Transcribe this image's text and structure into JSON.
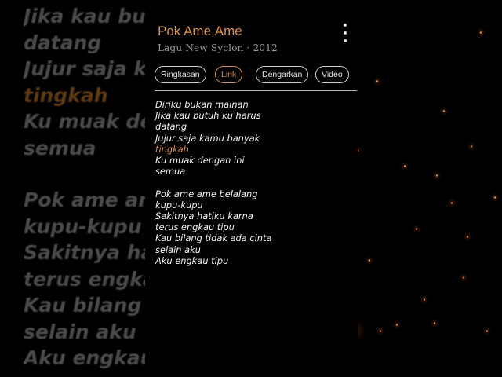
{
  "song": {
    "title": "Pok Ame,Ame",
    "subtitle": "Lagu New Syclon · 2012"
  },
  "tabs": [
    {
      "label": "Ringkasan",
      "active": false
    },
    {
      "label": "Lirik",
      "active": true
    },
    {
      "label": "Dengarkan",
      "active": false
    },
    {
      "label": "Video",
      "active": false
    }
  ],
  "lyrics": {
    "stanza1": [
      {
        "text": "Diriku bukan mainan"
      },
      {
        "text": "Jika kau butuh ku harus"
      },
      {
        "text": "datang"
      },
      {
        "text": "Jujur saja kamu banyak"
      },
      {
        "text": "tingkah",
        "highlight": true
      },
      {
        "text": "Ku muak dengan ini"
      },
      {
        "text": "semua"
      }
    ],
    "stanza2": [
      {
        "text": "Pok ame ame belalang"
      },
      {
        "text": "kupu-kupu"
      },
      {
        "text": "Sakitnya hatiku karna"
      },
      {
        "text": "terus engkau tipu"
      },
      {
        "text": "Kau bilang tidak ada cinta"
      },
      {
        "text": "selain aku"
      },
      {
        "text": "Aku engkau tipu"
      }
    ]
  },
  "background_lyrics": {
    "stanza1": [
      {
        "text": "Jika kau butuh ku harus"
      },
      {
        "text": "datang"
      },
      {
        "text": "Jujur saja kamu banyak"
      },
      {
        "text": "tingkah",
        "highlight": true
      },
      {
        "text": "Ku muak dengan ini"
      },
      {
        "text": "semua"
      }
    ],
    "stanza2": [
      {
        "text": "Pok ame ame belalang"
      },
      {
        "text": "kupu-kupu"
      },
      {
        "text": "Sakitnya hatiku karna"
      },
      {
        "text": "terus engkau tipu"
      },
      {
        "text": "Kau bilang tidak ada cinta"
      },
      {
        "text": "selain aku"
      },
      {
        "text": "Aku engkau tipu"
      }
    ]
  },
  "colors": {
    "accent": "#d8904a",
    "background": "#000000",
    "text": "#f2f2f2"
  },
  "icons": {
    "menu": "more-vertical-icon"
  }
}
